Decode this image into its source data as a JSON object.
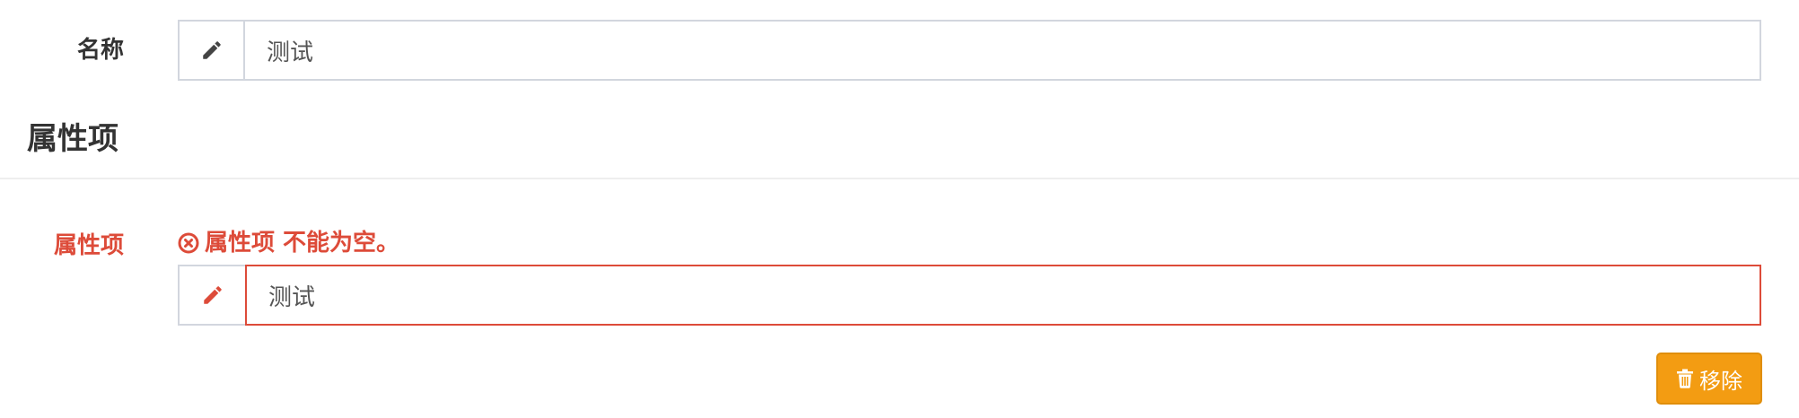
{
  "form": {
    "name_field": {
      "label": "名称",
      "value": "测试",
      "icon": "pencil-icon"
    },
    "section": {
      "title": "属性项"
    },
    "attribute_field": {
      "label": "属性项",
      "error_message": "属性项 不能为空。",
      "error_icon": "times-circle-icon",
      "value": "测试",
      "icon": "pencil-icon"
    },
    "remove_button": {
      "label": "移除",
      "icon": "trash-icon"
    }
  },
  "colors": {
    "error": "#dd4b39",
    "warning_button": "#f39c12",
    "border": "#d2d6de",
    "text": "#333333"
  }
}
